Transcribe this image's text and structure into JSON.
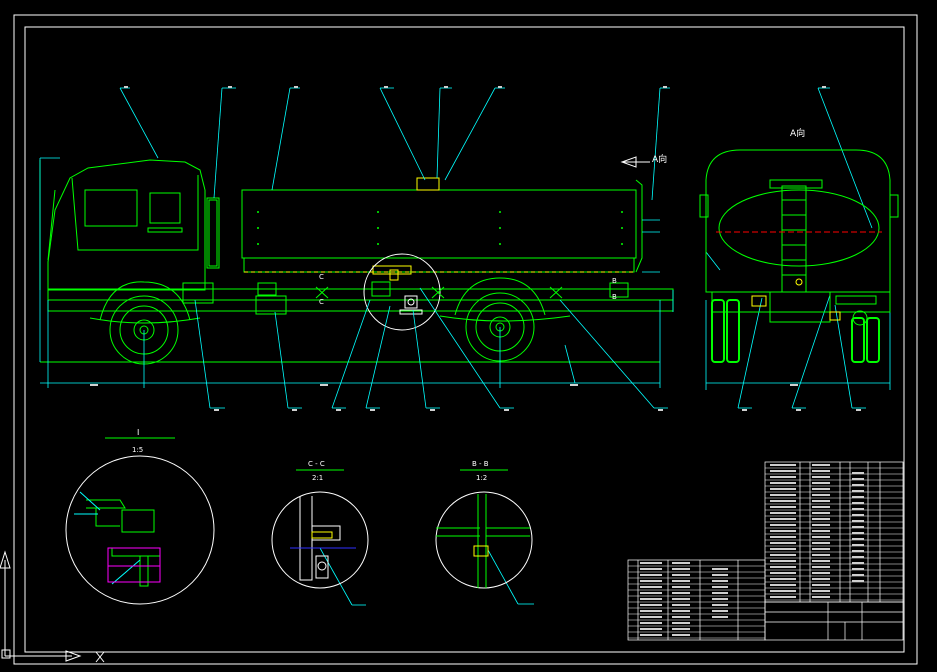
{
  "views": {
    "view_a_label": "A向",
    "view_a_arrow_label": "A向",
    "detail_i_title": "I",
    "detail_i_scale": "1:5",
    "section_cc_title": "C - C",
    "section_cc_scale": "2:1",
    "section_bb_title": "B - B",
    "section_bb_scale": "1:2"
  },
  "section_markers": {
    "c_top": "C",
    "c_bottom": "C",
    "b_top": "B",
    "b_bottom": "B"
  },
  "colors": {
    "frame": "#ffffff",
    "outline": "#00ff00",
    "leader": "#00ffff",
    "highlight": "#ffff00",
    "centerline": "#ff0000",
    "hidden": "#ff00ff",
    "section_line": "#3030ff"
  },
  "icons": {
    "ucs": "ucs-axis-icon"
  }
}
